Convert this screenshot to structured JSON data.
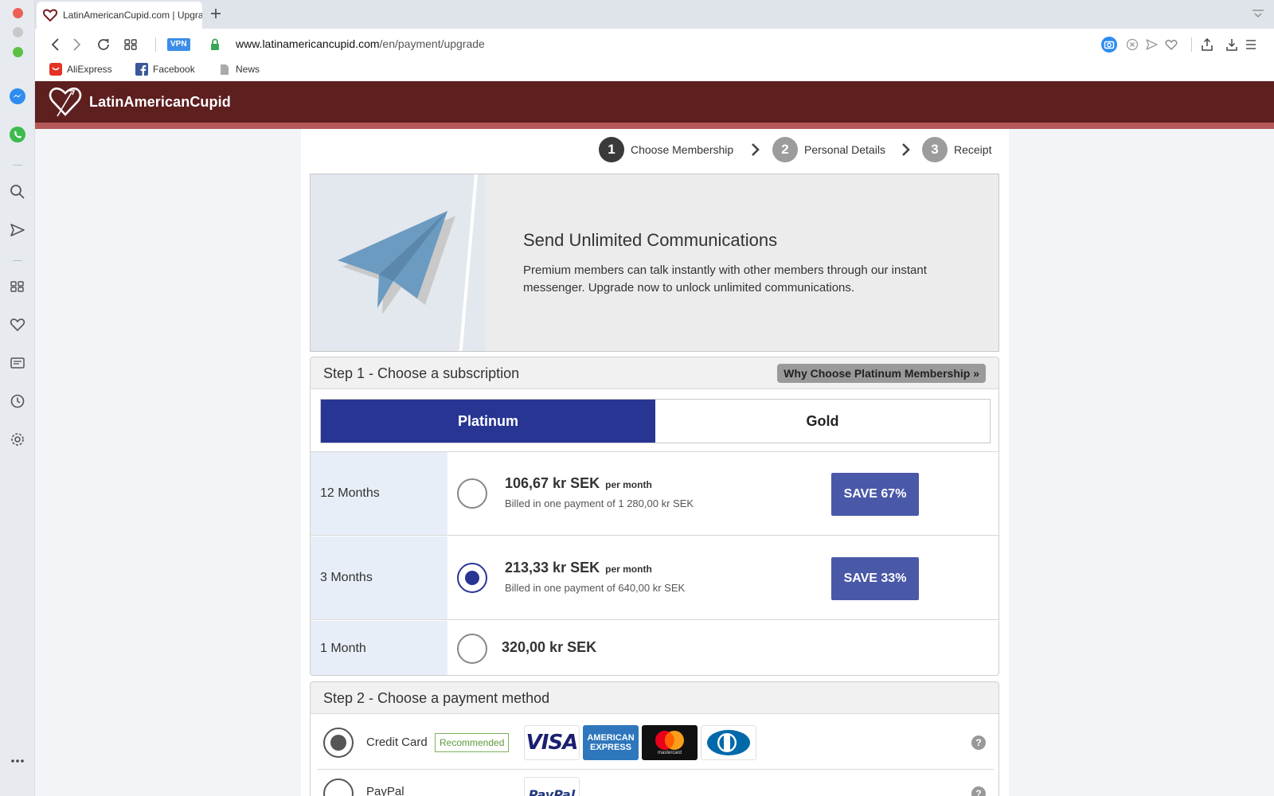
{
  "browser": {
    "tab_title": "LatinAmericanCupid.com | Upgrade",
    "url_host": "www.latinamericancupid.com",
    "url_path": "/en/payment/upgrade",
    "vpn_label": "VPN",
    "bookmarks": [
      {
        "label": "AliExpress",
        "icon": "aliexpress-icon"
      },
      {
        "label": "Facebook",
        "icon": "facebook-icon"
      },
      {
        "label": "News",
        "icon": "document-icon"
      }
    ],
    "sidebar_icons": [
      "messenger-icon",
      "whatsapp-icon",
      "search-icon",
      "send-icon",
      "grid-icon",
      "heart-icon",
      "news-icon",
      "history-icon",
      "settings-icon",
      "more-icon"
    ]
  },
  "site": {
    "logo_text": "LatinAmericanCupid",
    "colors": {
      "header": "#5e1f1f",
      "accent": "#283593",
      "save": "#4a58a8"
    }
  },
  "steps": [
    {
      "num": "1",
      "label": "Choose Membership",
      "active": true
    },
    {
      "num": "2",
      "label": "Personal Details",
      "active": false
    },
    {
      "num": "3",
      "label": "Receipt",
      "active": false
    }
  ],
  "banner": {
    "title": "Send Unlimited Communications",
    "text": "Premium members can talk instantly with other members through our instant messenger. Upgrade now to unlock unlimited communications."
  },
  "step1": {
    "title": "Step 1 - Choose a subscription",
    "why_button": "Why Choose Platinum Membership »",
    "tiers": [
      "Platinum",
      "Gold"
    ],
    "selected_tier": "Platinum",
    "plans": [
      {
        "label": "12 Months",
        "price": "106,67 kr SEK",
        "per": "per month",
        "billed": "Billed in one payment of 1 280,00 kr SEK",
        "save": "SAVE 67%",
        "selected": false
      },
      {
        "label": "3 Months",
        "price": "213,33 kr SEK",
        "per": "per month",
        "billed": "Billed in one payment of 640,00 kr SEK",
        "save": "SAVE 33%",
        "selected": true
      },
      {
        "label": "1 Month",
        "price": "320,00 kr SEK",
        "per": "",
        "billed": "",
        "save": "",
        "selected": false
      }
    ]
  },
  "step2": {
    "title": "Step 2 - Choose a payment method",
    "methods": [
      {
        "label": "Credit Card",
        "badge": "Recommended",
        "selected": true,
        "cards": [
          "VISA",
          "AMERICAN EXPRESS",
          "mastercard",
          "Diners Club"
        ]
      },
      {
        "label": "PayPal",
        "selected": false,
        "cards": [
          "PayPal"
        ]
      }
    ],
    "help": "?"
  }
}
